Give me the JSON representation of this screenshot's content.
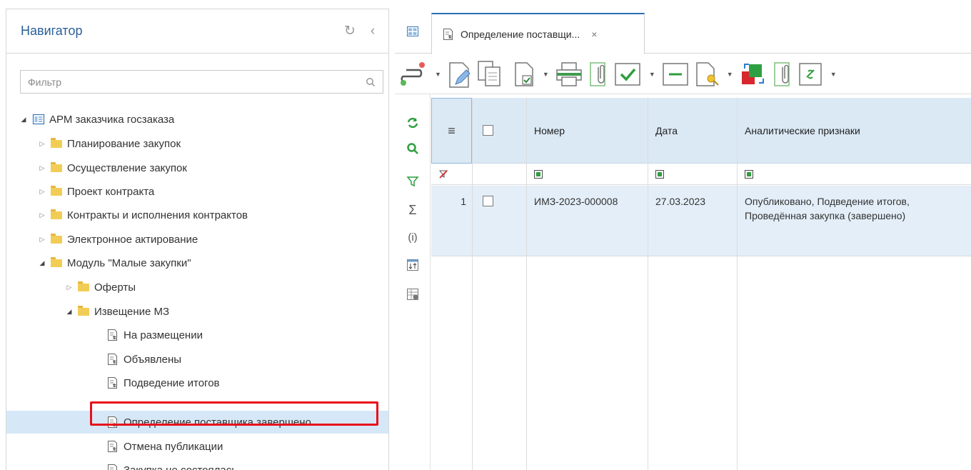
{
  "navigator": {
    "title": "Навигатор",
    "filter_placeholder": "Фильтр",
    "tree": [
      {
        "label": "АРМ заказчика госзаказа",
        "level": 0,
        "expanded": true,
        "icon": "app-icon"
      },
      {
        "label": "Планирование закупок",
        "level": 1,
        "expanded": false,
        "icon": "folder-icon"
      },
      {
        "label": "Осуществление закупок",
        "level": 1,
        "expanded": false,
        "icon": "folder-icon"
      },
      {
        "label": "Проект контракта",
        "level": 1,
        "expanded": false,
        "icon": "folder-icon"
      },
      {
        "label": "Контракты и исполнения контрактов",
        "level": 1,
        "expanded": false,
        "icon": "folder-icon"
      },
      {
        "label": "Электронное актирование",
        "level": 1,
        "expanded": false,
        "icon": "folder-icon"
      },
      {
        "label": "Модуль \"Малые закупки\"",
        "level": 1,
        "expanded": true,
        "icon": "folder-icon"
      },
      {
        "label": "Оферты",
        "level": 2,
        "expanded": false,
        "icon": "folder-icon"
      },
      {
        "label": "Извещение МЗ",
        "level": 2,
        "expanded": true,
        "icon": "folder-icon"
      },
      {
        "label": "На размещении",
        "level": 3,
        "icon": "document-icon"
      },
      {
        "label": "Объявлены",
        "level": 3,
        "icon": "document-icon"
      },
      {
        "label": "Подведение итогов",
        "level": 3,
        "icon": "document-icon"
      },
      {
        "label": "Определение поставщика завершено",
        "level": 3,
        "icon": "document-icon",
        "selected": true
      },
      {
        "label": "Отмена публикации",
        "level": 3,
        "icon": "document-icon"
      },
      {
        "label": "Закупка не состоялась",
        "level": 3,
        "icon": "document-icon"
      }
    ]
  },
  "tabs": {
    "active_label": "Определение поставщи...",
    "close_glyph": "×"
  },
  "grid": {
    "columns": [
      "Номер",
      "Дата",
      "Аналитические признаки"
    ],
    "rows": [
      {
        "index": "1",
        "number": "ИМЗ-2023-000008",
        "date": "27.03.2023",
        "attributes": "Опубликовано, Подведение итогов, Проведённая закупка (завершено)"
      }
    ]
  },
  "colors": {
    "accent": "#2a5f99",
    "header_bg": "#dbe9f5",
    "selected_row": "#d6e8f7",
    "highlight_border": "#e8101b",
    "folder": "#f2cd55"
  }
}
